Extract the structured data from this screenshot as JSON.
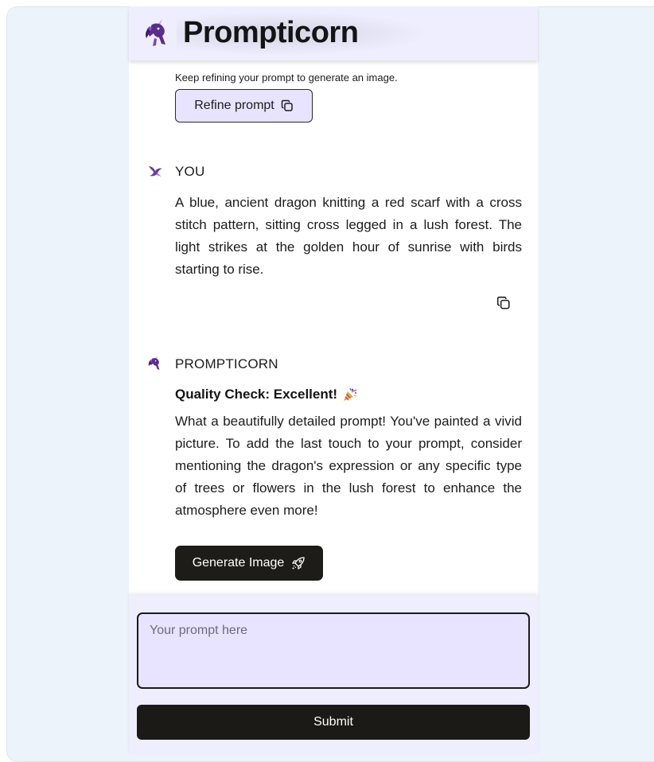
{
  "header": {
    "title": "Prompticorn",
    "logo_icon": "unicorn-icon"
  },
  "intro": {
    "text": "Keep refining your prompt to generate an image.",
    "refine_label": "Refine prompt",
    "refine_icon": "copy-icon"
  },
  "messages": [
    {
      "author": "YOU",
      "avatar_icon": "bird-icon",
      "body": "A blue, ancient dragon knitting a red scarf with a cross stitch pattern, sitting cross legged in a lush forest. The light strikes at the golden hour of sunrise with birds starting to rise.",
      "action_icon": "copy-icon"
    },
    {
      "author": "PROMPTICORN",
      "avatar_icon": "unicorn-icon",
      "quality_title": "Quality Check: Excellent!",
      "quality_icon": "party-popper-icon",
      "body": "What a beautifully detailed prompt! You've painted a vivid picture. To add the last touch to your prompt, consider mentioning the dragon's expression or any specific type of trees or flowers in the lush forest to enhance the atmosphere even more!",
      "generate_label": "Generate Image",
      "generate_icon": "rocket-icon"
    }
  ],
  "composer": {
    "placeholder": "Your prompt here",
    "value": "",
    "submit_label": "Submit"
  },
  "colors": {
    "page_background": "#edf3fb",
    "header_background": "#efeeff",
    "button_lavender": "#e8e3ff",
    "button_dark": "#1d1c18",
    "brand_purple": "#6b3fa0"
  }
}
